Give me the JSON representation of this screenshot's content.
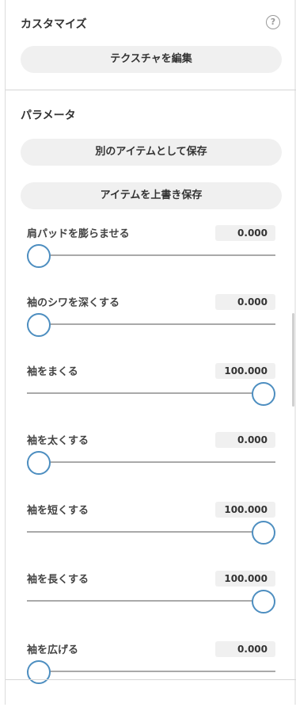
{
  "customize": {
    "title": "カスタマイズ",
    "help_icon": "question-circle-icon",
    "help_glyph": "?",
    "edit_texture_label": "テクスチャを編集"
  },
  "params": {
    "title": "パラメータ",
    "save_as_new_label": "別のアイテムとして保存",
    "overwrite_label": "アイテムを上書き保存"
  },
  "sliders": [
    {
      "label": "肩パッドを膨らませる",
      "value": "0.000",
      "level": 0
    },
    {
      "label": "袖のシワを深くする",
      "value": "0.000",
      "level": 0
    },
    {
      "label": "袖をまくる",
      "value": "100.000",
      "level": 1
    },
    {
      "label": "袖を太くする",
      "value": "0.000",
      "level": 0
    },
    {
      "label": "袖を短くする",
      "value": "100.000",
      "level": 1
    },
    {
      "label": "袖を長くする",
      "value": "100.000",
      "level": 1
    },
    {
      "label": "袖を広げる",
      "value": "0.000",
      "level": 0
    }
  ],
  "colors": {
    "accent": "#4d8ec0",
    "track": "#a9a9a9",
    "pill_bg": "#f0f0f0"
  }
}
